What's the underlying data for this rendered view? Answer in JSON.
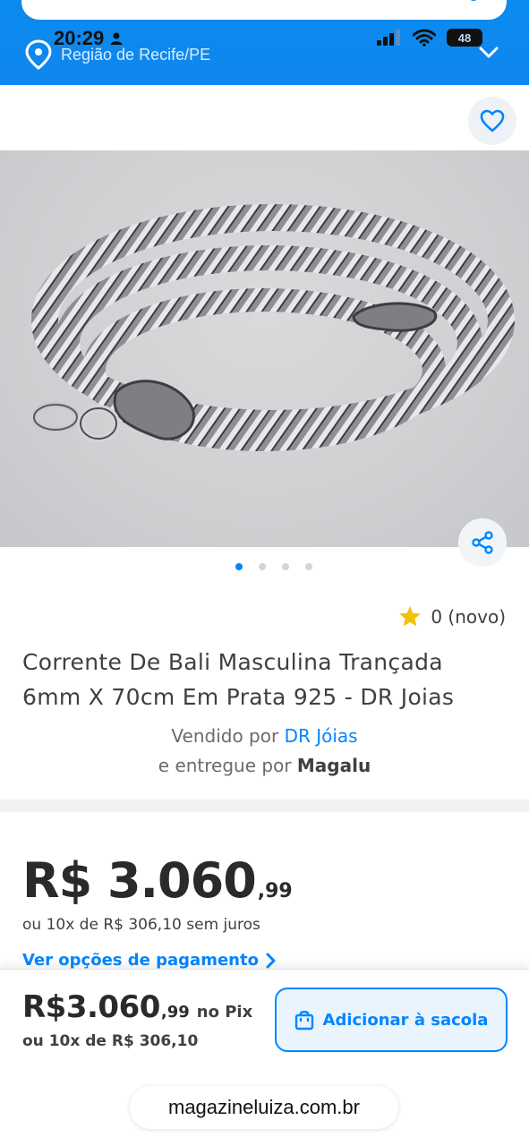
{
  "status_bar": {
    "time": "20:29",
    "battery": "48"
  },
  "header": {
    "region": "Região de Recife/PE"
  },
  "product": {
    "rating": "0 (novo)",
    "title": "Corrente De Bali Masculina Trançada 6mm X 70cm Em Prata 925 - DR Joias",
    "sold_by_label": "Vendido por",
    "seller_name": "DR Jóias",
    "delivered_by_label": "e entregue por",
    "delivered_by": "Magalu",
    "gallery_dots": 4,
    "gallery_active": 0
  },
  "price": {
    "main": "R$ 3.060",
    "cents": ",99",
    "installments": "ou 10x de R$ 306,10 sem juros",
    "payment_options": "Ver opções de pagamento"
  },
  "bottom_bar": {
    "pix_price": "R$3.060",
    "pix_cents": ",99",
    "pix_suffix": "no Pix",
    "installments": "ou 10x de R$ 306,10",
    "add_to_bag": "Adicionar à sacola",
    "url": "magazineluiza.com.br"
  },
  "colors": {
    "brand_blue": "#0086ff",
    "header_blue": "#0f86ee",
    "star": "#f2c20b"
  }
}
